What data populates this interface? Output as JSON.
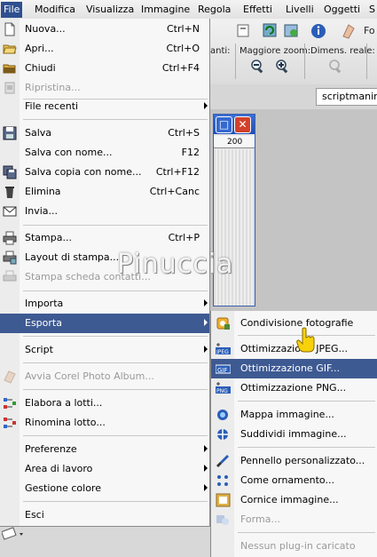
{
  "menubar": {
    "items": [
      {
        "label": "File",
        "active": true
      },
      {
        "label": "Modifica"
      },
      {
        "label": "Visualizza"
      },
      {
        "label": "Immagine"
      },
      {
        "label": "Regola"
      },
      {
        "label": "Effetti"
      },
      {
        "label": "Livelli"
      },
      {
        "label": "Oggetti"
      },
      {
        "label": "S"
      }
    ]
  },
  "toolbar": {
    "partial_label": "anti:",
    "zoom_label": "Maggiore zoom:",
    "real_size_label": "Dimens. reale:",
    "right_cut_text": "Fo"
  },
  "tabs": {
    "active_tab": "scriptmanina"
  },
  "image_window": {
    "ruler_mark": "200"
  },
  "watermark": {
    "text": "Pinuccia"
  },
  "file_menu": {
    "items": [
      {
        "label": "Nuova...",
        "shortcut": "Ctrl+N",
        "icon": "new-file-icon"
      },
      {
        "label": "Apri...",
        "shortcut": "Ctrl+O",
        "icon": "open-folder-icon"
      },
      {
        "label": "Chiudi",
        "shortcut": "Ctrl+F4",
        "icon": "close-folder-icon"
      },
      {
        "label": "Ripristina...",
        "shortcut": "",
        "icon": "revert-icon",
        "disabled": true
      },
      {
        "label": "File recenti",
        "shortcut": "",
        "submenu": true
      },
      {
        "label": "Salva",
        "shortcut": "Ctrl+S",
        "icon": "save-icon"
      },
      {
        "label": "Salva con nome...",
        "shortcut": "F12"
      },
      {
        "label": "Salva copia con nome...",
        "shortcut": "Ctrl+F12",
        "icon": "save-copy-icon"
      },
      {
        "label": "Elimina",
        "shortcut": "Ctrl+Canc",
        "icon": "trash-icon"
      },
      {
        "label": "Invia...",
        "shortcut": "",
        "icon": "send-icon"
      },
      {
        "label": "Stampa...",
        "shortcut": "Ctrl+P",
        "icon": "printer-icon"
      },
      {
        "label": "Layout di stampa...",
        "shortcut": "",
        "icon": "print-layout-icon"
      },
      {
        "label": "Stampa scheda contatti...",
        "shortcut": "",
        "icon": "contact-sheet-icon",
        "disabled": true
      },
      {
        "label": "Importa",
        "shortcut": "",
        "submenu": true
      },
      {
        "label": "Esporta",
        "shortcut": "",
        "submenu": true,
        "highlighted": true
      },
      {
        "label": "Script",
        "shortcut": "",
        "submenu": true
      },
      {
        "label": "Avvia Corel Photo Album...",
        "shortcut": "",
        "icon": "photo-album-icon",
        "disabled": true
      },
      {
        "label": "Elabora a lotti...",
        "shortcut": "",
        "icon": "batch-process-icon"
      },
      {
        "label": "Rinomina lotto...",
        "shortcut": "",
        "icon": "batch-rename-icon"
      },
      {
        "label": "Preferenze",
        "shortcut": "",
        "submenu": true
      },
      {
        "label": "Area di lavoro",
        "shortcut": "",
        "submenu": true
      },
      {
        "label": "Gestione colore",
        "shortcut": "",
        "submenu": true
      },
      {
        "label": "Esci",
        "shortcut": ""
      }
    ]
  },
  "export_submenu": {
    "items": [
      {
        "label": "Condivisione fotografie",
        "icon": "photo-share-icon"
      },
      {
        "label": "Ottimizzazione JPEG...",
        "icon": "jpeg-optimizer-icon"
      },
      {
        "label": "Ottimizzazione GIF...",
        "icon": "gif-optimizer-icon",
        "highlighted": true
      },
      {
        "label": "Ottimizzazione PNG...",
        "icon": "png-optimizer-icon"
      },
      {
        "label": "Mappa immagine...",
        "icon": "image-map-icon"
      },
      {
        "label": "Suddividi immagine...",
        "icon": "image-slicer-icon"
      },
      {
        "label": "Pennello personalizzato...",
        "icon": "custom-brush-icon"
      },
      {
        "label": "Come ornamento...",
        "icon": "picture-tube-icon"
      },
      {
        "label": "Cornice immagine...",
        "icon": "picture-frame-icon"
      },
      {
        "label": "Forma...",
        "icon": "shape-icon",
        "disabled": true
      },
      {
        "label": "Nessun plug-in caricato",
        "disabled": true
      }
    ]
  },
  "colors": {
    "highlight": "#3e5a92",
    "titlebar": "#1f4eb5",
    "close_button": "#d2422b"
  }
}
